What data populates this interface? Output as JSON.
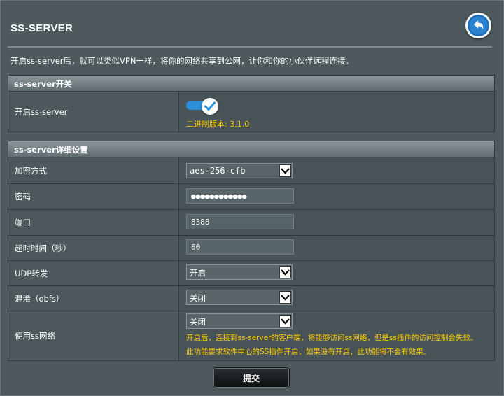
{
  "page": {
    "title": "SS-SERVER",
    "description": "开启ss-server后，就可以类似VPN一样，将你的网络共享到公网，让你和你的小伙伴远程连接。"
  },
  "section_switch": {
    "header": "ss-server开关",
    "enable_label": "开启ss-server",
    "enabled": true,
    "version_text": "二进制版本: 3.1.0"
  },
  "section_details": {
    "header": "ss-server详细设置",
    "rows": {
      "encryption": {
        "label": "加密方式",
        "value": "aes-256-cfb"
      },
      "password": {
        "label": "密码",
        "value": "●●●●●●●●●●●●"
      },
      "port": {
        "label": "端口",
        "value": "8388"
      },
      "timeout": {
        "label": "超时时间（秒）",
        "value": "60"
      },
      "udp": {
        "label": "UDP转发",
        "value": "开启"
      },
      "obfs": {
        "label": "混淆（obfs）",
        "value": "关闭"
      },
      "use_ss": {
        "label": "使用ss网络",
        "value": "关闭",
        "note_line1": "开启后，连接到ss-server的客户端，将能够访问ss网络，但是ss插件的访问控制会失效。",
        "note_line2": "此功能要求软件中心的SS插件开启，如果没有开启，此功能将不会有效果。"
      }
    }
  },
  "actions": {
    "submit_label": "提交"
  },
  "colors": {
    "accent": "#2b90d9",
    "warning": "#ffcc00",
    "panel": "#4d595d"
  },
  "icons": {
    "back": "back-arrow-icon",
    "check": "check-icon",
    "dropdown": "chevron-down-icon"
  }
}
